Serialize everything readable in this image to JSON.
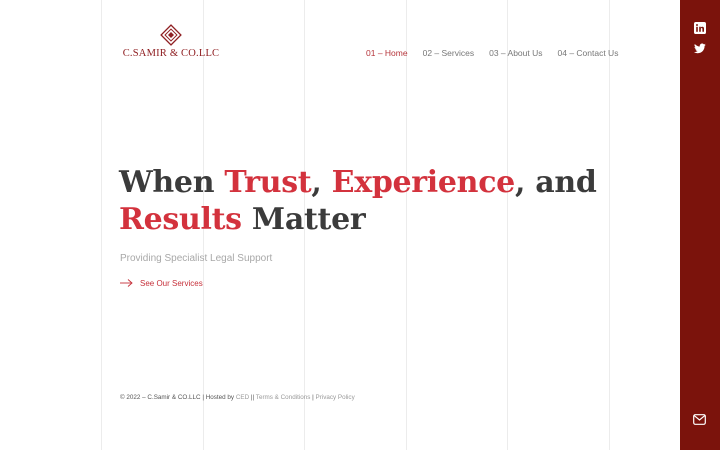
{
  "brand": {
    "name": "C.SAMIR & CO.LLC"
  },
  "nav": {
    "items": [
      {
        "label": "01 – Home"
      },
      {
        "label": "02 – Services"
      },
      {
        "label": "03 – About Us"
      },
      {
        "label": "04 – Contact Us"
      }
    ]
  },
  "hero": {
    "w1": "When ",
    "w2": "Trust",
    "w3": ", ",
    "w4": "Experience",
    "w5": ", and",
    "w6": "Results",
    "w7": " Matter",
    "subtitle": "Providing Specialist Legal Support",
    "cta_label": "See Our Services"
  },
  "footer": {
    "copyright": "© 2022 – C.Samir & CO.LLC | Hosted by ",
    "host": "CED",
    "sep1": " || ",
    "terms": "Terms & Conditions",
    "sep2": " | ",
    "privacy": "Privacy Policy"
  },
  "sidebar": {
    "icons": [
      "linkedin-icon",
      "twitter-icon",
      "mail-icon"
    ]
  },
  "colors": {
    "accent": "#d3323d",
    "brand": "#8f1f22",
    "sidebar": "#7b130c"
  }
}
